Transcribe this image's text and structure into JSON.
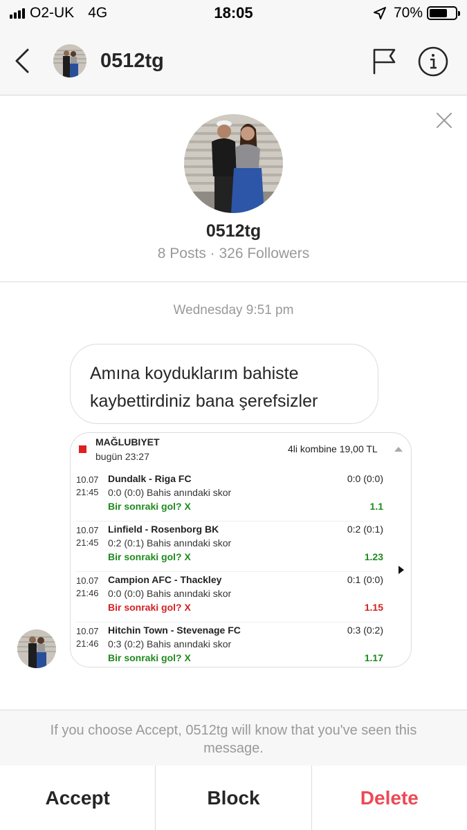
{
  "status_bar": {
    "carrier": "O2-UK",
    "network": "4G",
    "time": "18:05",
    "battery": "70%",
    "battery_level": 0.7
  },
  "header": {
    "username": "0512tg",
    "back_icon": "chevron-left-icon",
    "report_icon": "flag-icon",
    "info_icon": "info-icon"
  },
  "profile": {
    "username": "0512tg",
    "stats": "8 Posts · 326 Followers"
  },
  "conversation": {
    "timestamp": "Wednesday 9:51 pm",
    "message_text": "Amına koyduklarım bahiste kaybettirdiniz bana şerefsizler",
    "bet_slip": {
      "status": "MAĞLUBIYET",
      "date": "bugün 23:27",
      "combo": "4li kombine 19,00 TL",
      "rows": [
        {
          "date": "10.07",
          "time": "21:45",
          "match": "Dundalk - Riga FC",
          "score": "0:0 (0:0)",
          "note": "0:0 (0:0) Bahis anındaki skor",
          "pick": "Bir sonraki gol? X",
          "odd": "1.1",
          "result": "won"
        },
        {
          "date": "10.07",
          "time": "21:45",
          "match": "Linfield - Rosenborg BK",
          "score": "0:2 (0:1)",
          "note": "0:2 (0:1) Bahis anındaki skor",
          "pick": "Bir sonraki gol? X",
          "odd": "1.23",
          "result": "won"
        },
        {
          "date": "10.07",
          "time": "21:46",
          "match": "Campion AFC - Thackley",
          "score": "0:1 (0:0)",
          "note": "0:0 (0:0) Bahis anındaki skor",
          "pick": "Bir sonraki gol? X",
          "odd": "1.15",
          "result": "lost"
        },
        {
          "date": "10.07",
          "time": "21:46",
          "match": "Hitchin Town - Stevenage FC",
          "score": "0:3 (0:2)",
          "note": "0:3 (0:2) Bahis anındaki skor",
          "pick": "Bir sonraki gol? X",
          "odd": "1.17",
          "result": "won"
        }
      ]
    }
  },
  "request": {
    "notice": "If you choose Accept, 0512tg will know that you've seen this message.",
    "accept_label": "Accept",
    "block_label": "Block",
    "delete_label": "Delete"
  },
  "colors": {
    "delete": "#ed4956",
    "won": "#1e8a1e",
    "lost": "#d32020",
    "muted": "#999999"
  }
}
